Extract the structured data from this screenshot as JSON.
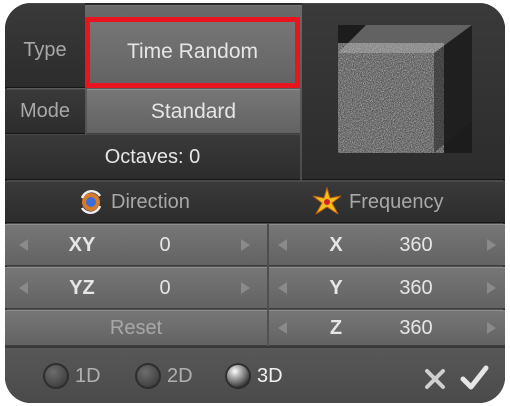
{
  "top": {
    "type_label": "Type",
    "type_value": "Time Random",
    "mode_label": "Mode",
    "mode_value": "Standard",
    "octaves": "Octaves: 0"
  },
  "headers": {
    "direction": "Direction",
    "frequency": "Frequency"
  },
  "direction": {
    "rows": [
      {
        "axis": "XY",
        "value": "0"
      },
      {
        "axis": "YZ",
        "value": "0"
      }
    ],
    "reset_label": "Reset"
  },
  "frequency": {
    "rows": [
      {
        "axis": "X",
        "value": "360"
      },
      {
        "axis": "Y",
        "value": "360"
      },
      {
        "axis": "Z",
        "value": "360"
      }
    ]
  },
  "dimensions": {
    "options": [
      "1D",
      "2D",
      "3D"
    ],
    "selected": "3D"
  },
  "icons": {
    "direction": "direction-icon",
    "frequency": "frequency-icon",
    "cancel": "cancel-icon",
    "confirm": "confirm-icon"
  },
  "colors": {
    "highlight": "#e8141e"
  }
}
